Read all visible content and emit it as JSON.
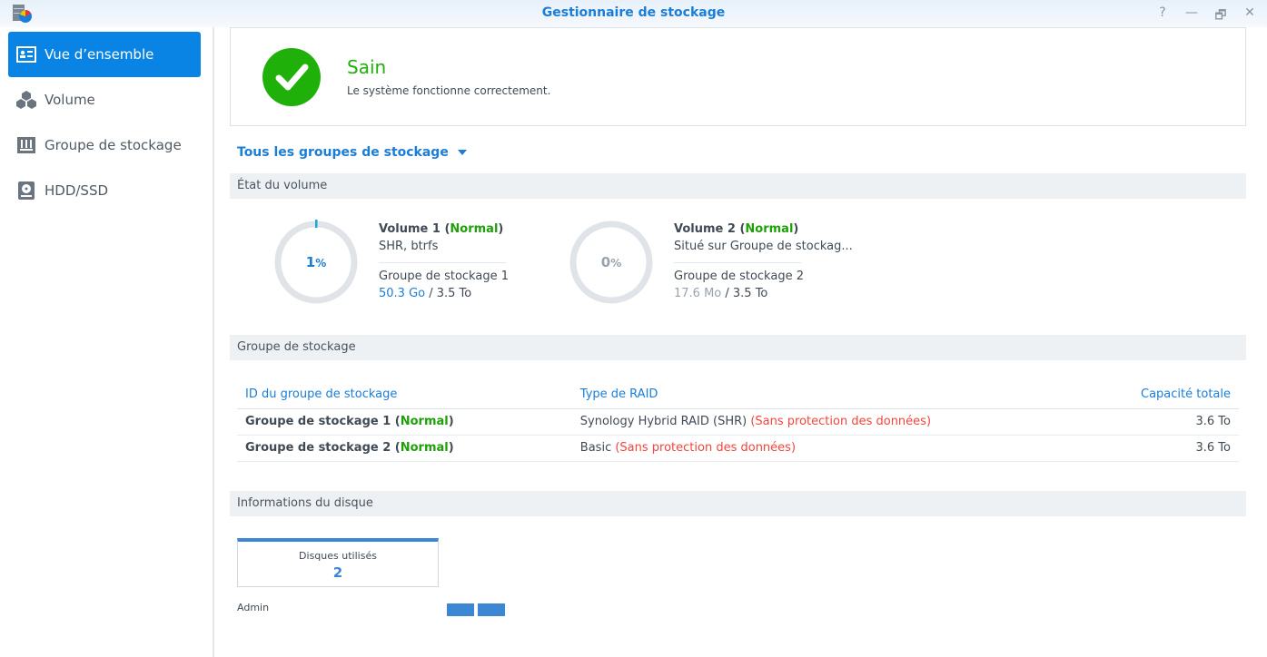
{
  "window": {
    "title": "Gestionnaire de stockage",
    "buttons": [
      "?",
      "—",
      "🗗",
      "✕"
    ]
  },
  "sidebar": {
    "items": [
      {
        "label": "Vue d’ensemble",
        "icon": "overview-icon",
        "active": true
      },
      {
        "label": "Volume",
        "icon": "cubes-icon"
      },
      {
        "label": "Groupe de stockage",
        "icon": "storage-pool-icon"
      },
      {
        "label": "HDD/SSD",
        "icon": "disk-icon"
      }
    ]
  },
  "health": {
    "status": "Sain",
    "message": "Le système fonctionne correctement.",
    "color": "#1fb00a"
  },
  "filter": {
    "label": "Tous les groupes de stockage"
  },
  "volume_section": {
    "title": "État du volume",
    "volumes": [
      {
        "name": "Volume 1 (",
        "status": "Normal",
        "close": ")",
        "desc": "SHR, btrfs",
        "pool": "Groupe de stockage 1",
        "used": "50.3 Go",
        "total": " / 3.5 To",
        "percent_num": "1",
        "percent_sign": "%",
        "usage": 0.01
      },
      {
        "name": "Volume 2 (",
        "status": "Normal",
        "close": ")",
        "desc": "Situé sur Groupe de stockag...",
        "pool": "Groupe de stockage 2",
        "used": "17.6 Mo",
        "total": " / 3.5 To",
        "percent_num": "0",
        "percent_sign": "%",
        "usage": 0
      }
    ]
  },
  "pool_section": {
    "title": "Groupe de stockage",
    "headers": [
      "ID du groupe de stockage",
      "Type de RAID",
      "Capacité totale"
    ],
    "rows": [
      {
        "name": "Groupe de stockage 1 (",
        "status": "Normal",
        "close": ")",
        "raid": "Synology Hybrid RAID (SHR)",
        "warn": "(Sans protection des données)",
        "cap": "3.6 To"
      },
      {
        "name": "Groupe de stockage 2 (",
        "status": "Normal",
        "close": ")",
        "raid": "Basic",
        "warn": "(Sans protection des données)",
        "cap": "3.6 To"
      }
    ]
  },
  "disk_section": {
    "title": "Informations du disque",
    "card_label": "Disques utilisés",
    "card_value": "2",
    "owner": "Admin"
  }
}
